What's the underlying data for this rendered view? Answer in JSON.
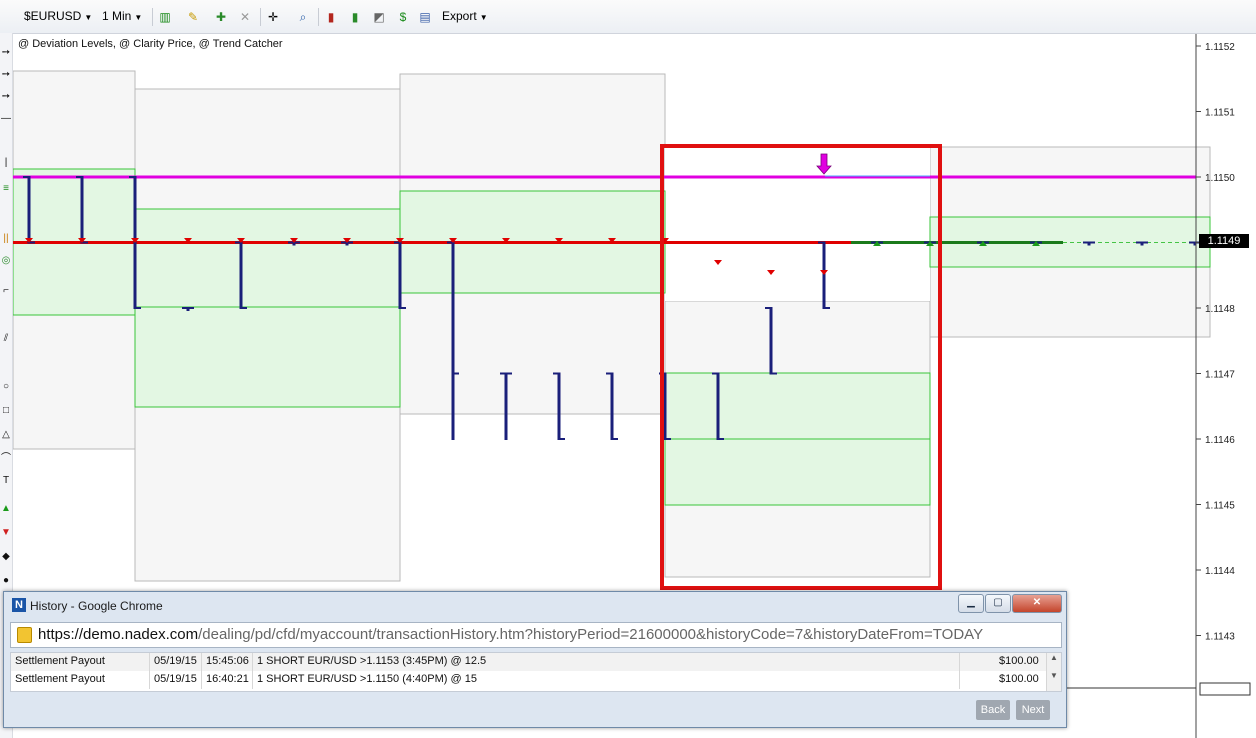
{
  "toolbar": {
    "symbol": "$EURUSD",
    "interval": "1 Min",
    "export_label": "Export"
  },
  "studies_label": "@ Deviation Levels, @ Clarity Price, @ Trend Catcher",
  "price_axis": {
    "ticks": [
      "1.1152",
      "1.1151",
      "1.1150",
      "1.1149",
      "1.1148",
      "1.1147",
      "1.1146",
      "1.1145",
      "1.1144",
      "1.1143"
    ],
    "current_price": "1.1149"
  },
  "chart_data": {
    "type": "bar",
    "title": "",
    "xlabel": "",
    "ylabel": "",
    "ylim": [
      1.11425,
      1.11525
    ],
    "x": [
      0,
      1,
      2,
      3,
      4,
      5,
      6,
      7,
      8,
      9,
      10,
      11,
      12,
      13,
      14,
      15,
      16,
      17,
      18,
      19,
      20,
      21,
      22
    ],
    "bars": [
      {
        "high": 1.115,
        "low": 1.1149,
        "close": 1.1149
      },
      {
        "high": 1.115,
        "low": 1.1149,
        "close": 1.1149
      },
      {
        "high": 1.115,
        "low": 1.1148,
        "close": 1.1148
      },
      {
        "high": 1.1148,
        "low": 1.1148,
        "close": 1.1148
      },
      {
        "high": 1.1149,
        "low": 1.1148,
        "close": 1.1148
      },
      {
        "high": 1.1149,
        "low": 1.1149,
        "close": 1.1149
      },
      {
        "high": 1.1149,
        "low": 1.1149,
        "close": 1.1149
      },
      {
        "high": 1.1149,
        "low": 1.1148,
        "close": 1.1148
      },
      {
        "high": 1.1149,
        "low": 1.1146,
        "close": 1.1147
      },
      {
        "high": 1.1147,
        "low": 1.1146,
        "close": 1.1147
      },
      {
        "high": 1.1147,
        "low": 1.1146,
        "close": 1.1146
      },
      {
        "high": 1.1147,
        "low": 1.1146,
        "close": 1.1146
      },
      {
        "high": 1.1147,
        "low": 1.1146,
        "close": 1.1146
      },
      {
        "high": 1.1147,
        "low": 1.1146,
        "close": 1.1146
      },
      {
        "high": 1.1148,
        "low": 1.1147,
        "close": 1.1147
      },
      {
        "high": 1.1149,
        "low": 1.1148,
        "close": 1.1148
      },
      {
        "high": 1.1149,
        "low": 1.1149,
        "close": 1.1149
      },
      {
        "high": 1.1149,
        "low": 1.1149,
        "close": 1.1149
      },
      {
        "high": 1.1149,
        "low": 1.1149,
        "close": 1.1149
      },
      {
        "high": 1.1149,
        "low": 1.1149,
        "close": 1.1149
      },
      {
        "high": 1.1149,
        "low": 1.1149,
        "close": 1.1149
      },
      {
        "high": 1.1149,
        "low": 1.1149,
        "close": 1.1149
      },
      {
        "high": 1.1149,
        "low": 1.1149,
        "close": 1.1149
      }
    ],
    "reference_lines": [
      {
        "value": 1.115,
        "color": "#e000e0"
      },
      {
        "value": 1.1149,
        "color": "#e00000"
      }
    ],
    "colors": {
      "bar": "#1a1f7a",
      "green_zone": "#e3f7e3",
      "green_border": "#39c439",
      "gray_zone": "#f6f6f6",
      "highlight_box": "#e01010"
    }
  },
  "popup": {
    "title": "History - Google Chrome",
    "url_host": "https://demo.nadex.com",
    "url_path": "/dealing/pd/cfd/myaccount/transactionHistory.htm?historyPeriod=21600000&historyCode=7&historyDateFrom=TODAY",
    "rows": [
      {
        "type": "Settlement Payout",
        "date": "05/19/15",
        "time": "15:45:06",
        "desc": "1 SHORT EUR/USD >1.1153 (3:45PM) @ 12.5",
        "amount": "$100.00"
      },
      {
        "type": "Settlement Payout",
        "date": "05/19/15",
        "time": "16:40:21",
        "desc": "1 SHORT EUR/USD >1.1150 (4:40PM) @ 15",
        "amount": "$100.00"
      }
    ],
    "back_label": "Back",
    "next_label": "Next"
  }
}
